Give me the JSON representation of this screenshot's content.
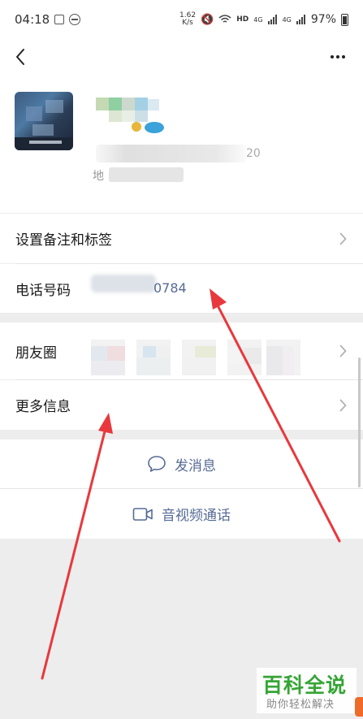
{
  "status_bar": {
    "time": "04:18",
    "net_speed_value": "1.62",
    "net_speed_unit": "K/s",
    "hd_label": "HD",
    "signal_label_1": "4G",
    "signal_label_2": "4G",
    "battery_percent": "97%"
  },
  "profile": {
    "id_suffix": "20",
    "region_label_visible": "地"
  },
  "rows": {
    "remark": {
      "label": "设置备注和标签"
    },
    "phone": {
      "label": "电话号码",
      "value_visible": "0784"
    },
    "moments": {
      "label": "朋友圈"
    },
    "more_info": {
      "label": "更多信息"
    }
  },
  "actions": {
    "message": {
      "label": "发消息"
    },
    "call": {
      "label": "音视频通话"
    }
  },
  "watermark": {
    "title": "百科全说",
    "subtitle": "助你轻松解决"
  },
  "colors": {
    "link_blue": "#576b95",
    "annotation_red": "#e8383d",
    "watermark_green": "#35a535"
  }
}
